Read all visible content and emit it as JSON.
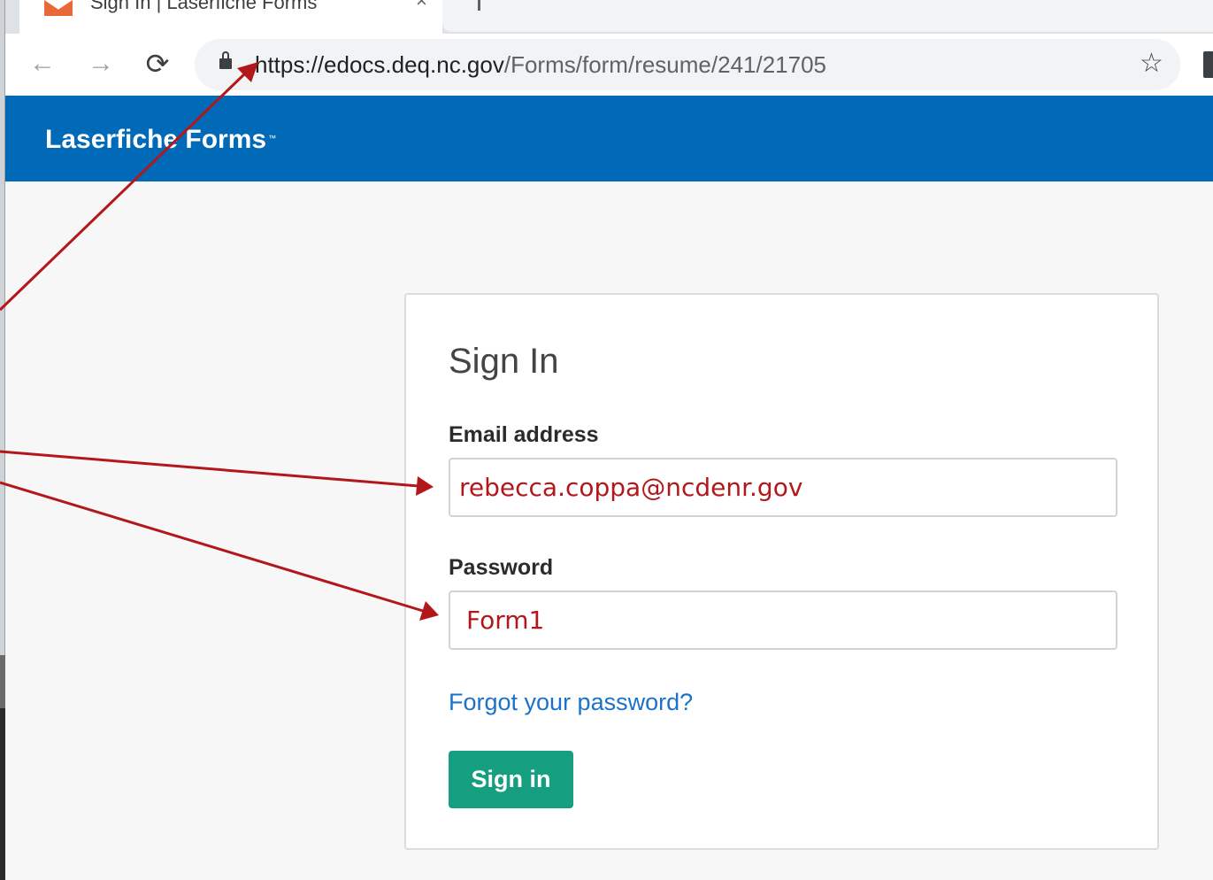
{
  "browser": {
    "tab": {
      "title": "Sign In | Laserfiche Forms",
      "close": "×"
    },
    "url": {
      "domain": "https://edocs.deq.nc.gov",
      "path": "/Forms/form/resume/241/21705"
    }
  },
  "icons": {
    "back": "←",
    "forward": "→",
    "reload": "⟳",
    "bookmark": "☆"
  },
  "banner": {
    "brand": "Laserfiche Forms",
    "trademark": "™"
  },
  "signin": {
    "heading": "Sign In",
    "email_label": "Email address",
    "email_value": "rebecca.coppa@ncdenr.gov",
    "password_label": "Password",
    "password_value": "Form1",
    "forgot_link": "Forgot your password?",
    "submit": "Sign in"
  },
  "colors": {
    "banner": "#0069b8",
    "button": "#159f80",
    "link": "#1a73c8",
    "annotation": "#b2181b"
  }
}
